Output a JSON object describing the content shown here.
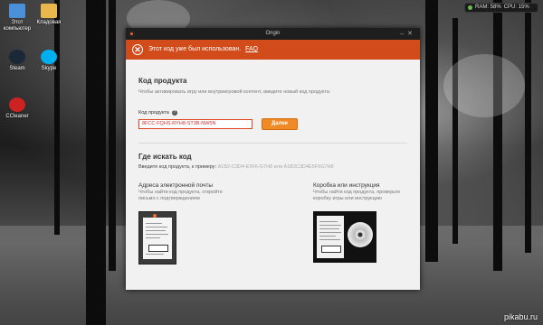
{
  "desktop": {
    "icons": [
      {
        "label": "Этот компьютер",
        "icon": "computer-icon",
        "color": "#4a90d9"
      },
      {
        "label": "Кладовая",
        "icon": "folder-icon",
        "color": "#e8b84a"
      },
      {
        "label": "Steam",
        "icon": "steam-icon",
        "color": "#1b2838"
      },
      {
        "label": "Skype",
        "icon": "skype-icon",
        "color": "#00aff0"
      },
      {
        "label": "CCleaner",
        "icon": "ccleaner-icon",
        "color": "#cc2222"
      }
    ],
    "tray": {
      "ram": "RAM: 58%",
      "cpu": "CPU: 15%"
    },
    "watermark": "pikabu.ru"
  },
  "window": {
    "title": "Origin",
    "error": {
      "message": "Этот код уже был использован.",
      "link": "FAQ",
      "color": "#d14b1b"
    },
    "code_section": {
      "heading": "Код продукта",
      "subtitle": "Чтобы активировать игру или внутриигровой контент, введите новый код продукта.",
      "field_label": "Код продукта",
      "field_value": "8FCC-FQHS-RYH8-ST3B-NW5N",
      "next_button": "Далее",
      "accent": "#f08a24"
    },
    "where_section": {
      "heading": "Где искать код",
      "example_prefix": "Введите код продукта, к примеру:",
      "example_codes": "A1B2-C3D4-E5F6-G7H8 или A1B2C3D4E5F6G7H8",
      "email": {
        "title": "Адреса электронной почты",
        "desc": "Чтобы найти код продукта, откройте письмо с подтверждением"
      },
      "box": {
        "title": "Коробка или инструкция",
        "desc": "Чтобы найти код продукта, проверьте коробку игры или инструкцию"
      }
    }
  }
}
